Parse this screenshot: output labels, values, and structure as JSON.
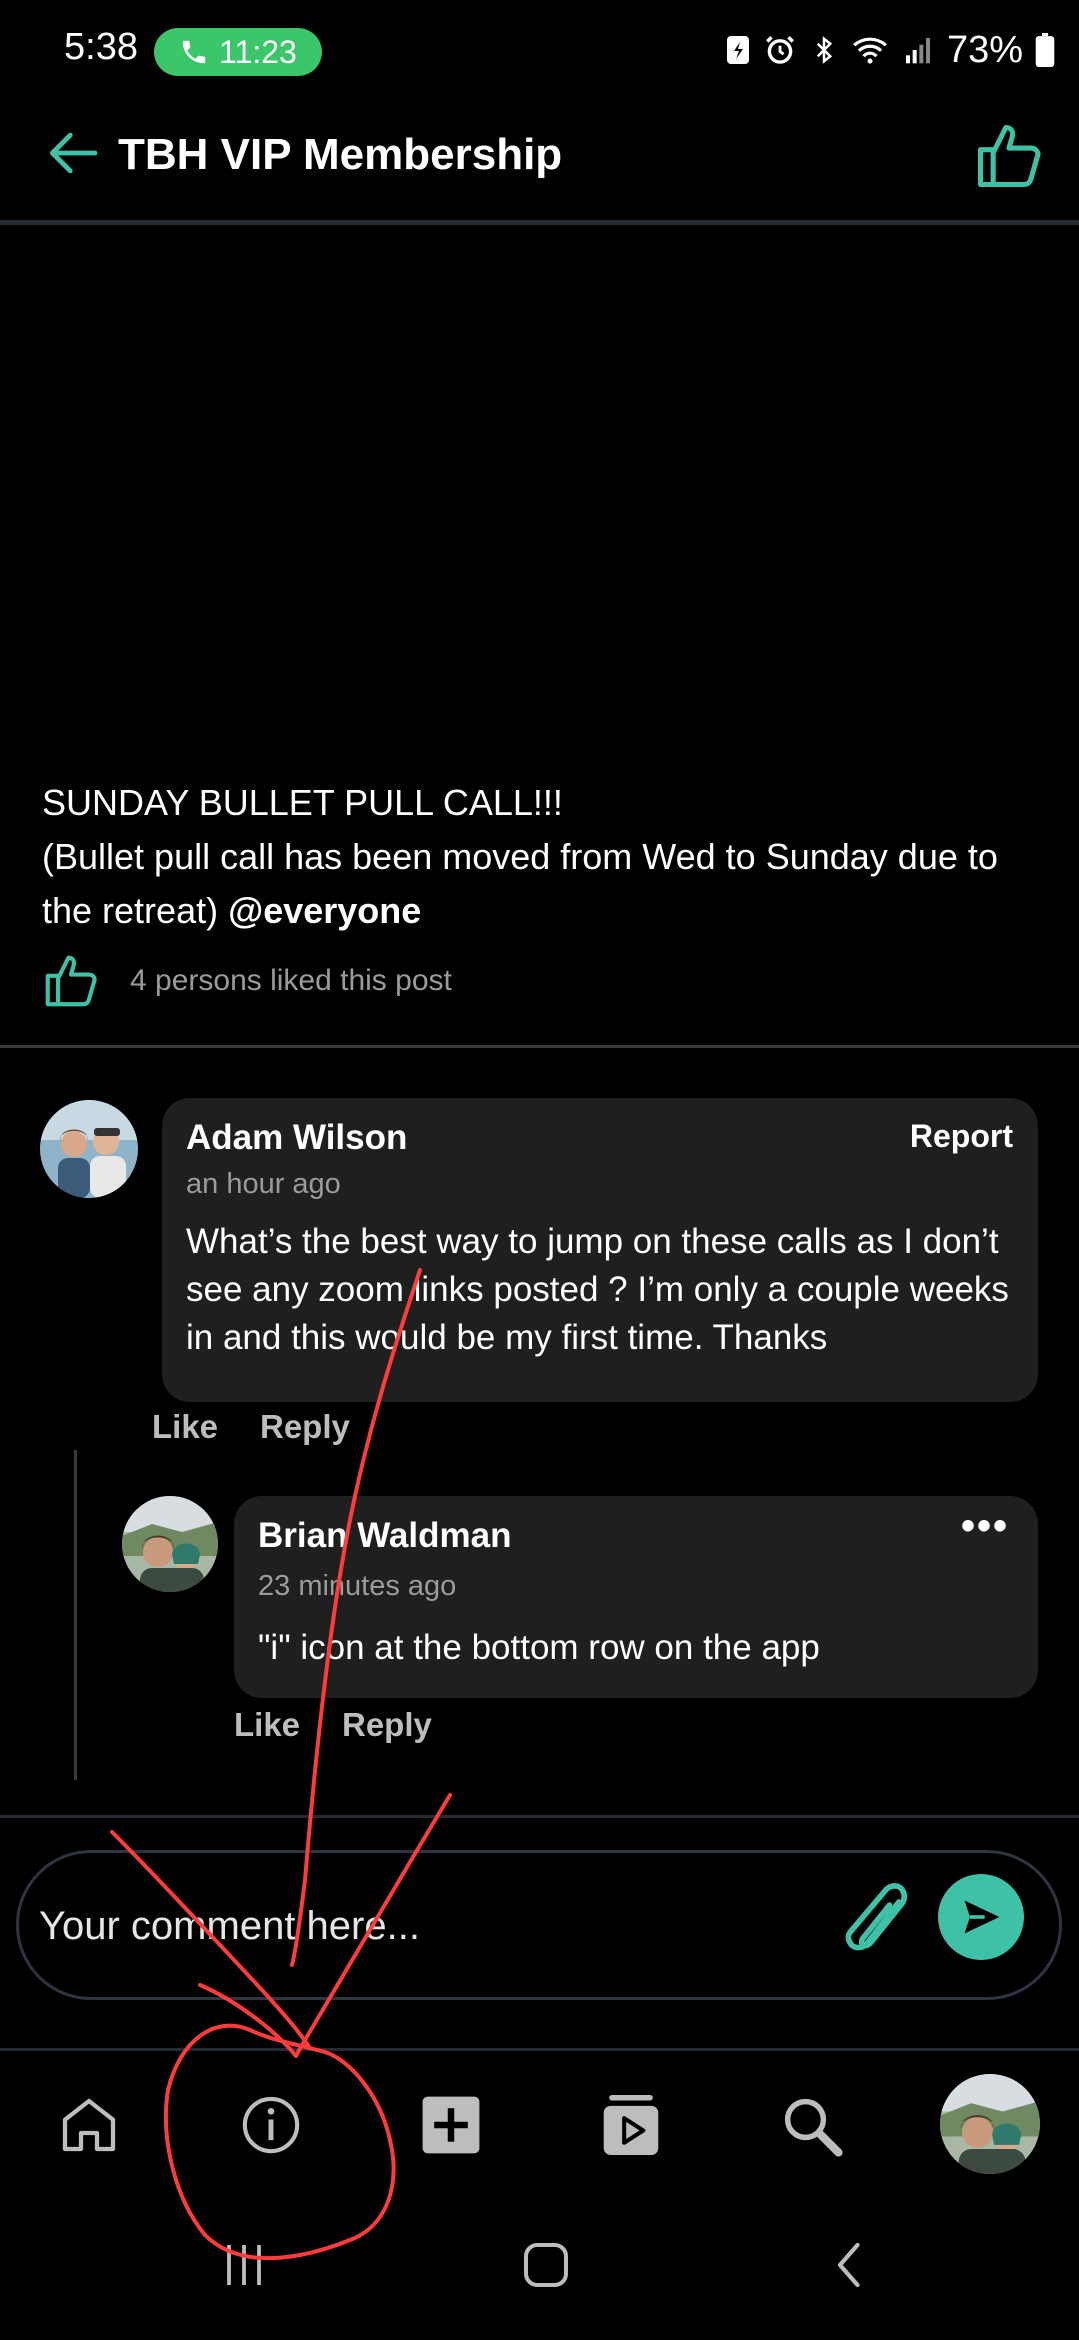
{
  "status_bar": {
    "time": "5:38",
    "call_timer": "11:23",
    "battery": "73%",
    "icons": [
      "phone-icon",
      "nfc-icon",
      "alarm-icon",
      "bluetooth-icon",
      "wifi-icon",
      "signal-icon",
      "battery-icon"
    ]
  },
  "header": {
    "title": "TBH VIP Membership",
    "back_icon": "arrow-left-icon",
    "like_icon": "thumbs-up-icon"
  },
  "post": {
    "text_line1": "SUNDAY BULLET PULL CALL!!!",
    "text_line2": "(Bullet pull call has been moved from Wed to Sunday due to the retreat) ",
    "mention": "@everyone",
    "likes_text": "4 persons liked this post"
  },
  "comments": [
    {
      "author": "Adam Wilson",
      "time": "an hour ago",
      "body": "What’s the best way to jump on these calls as I don’t see any zoom links posted ?  I’m only a couple weeks in and this would be my first time.  Thanks",
      "report_label": "Report",
      "like_label": "Like",
      "reply_label": "Reply"
    }
  ],
  "replies": [
    {
      "author": "Brian Waldman",
      "time": "23 minutes ago",
      "body": "\"i\" icon at the bottom row on the app",
      "more_label": "•••",
      "like_label": "Like",
      "reply_label": "Reply"
    }
  ],
  "composer": {
    "placeholder": "Your comment here...",
    "value": "",
    "attach_icon": "paperclip-icon",
    "send_icon": "send-icon"
  },
  "tab_bar": [
    "home-icon",
    "info-icon",
    "add-icon",
    "media-icon",
    "search-icon",
    "profile-avatar"
  ],
  "system_nav": [
    "recents-icon",
    "home-icon",
    "back-icon"
  ],
  "colors": {
    "accent": "#3ec1a7",
    "call_pill": "#3cc66a",
    "bubble": "#1f1f1f",
    "annotation": "#ff3b3b"
  }
}
